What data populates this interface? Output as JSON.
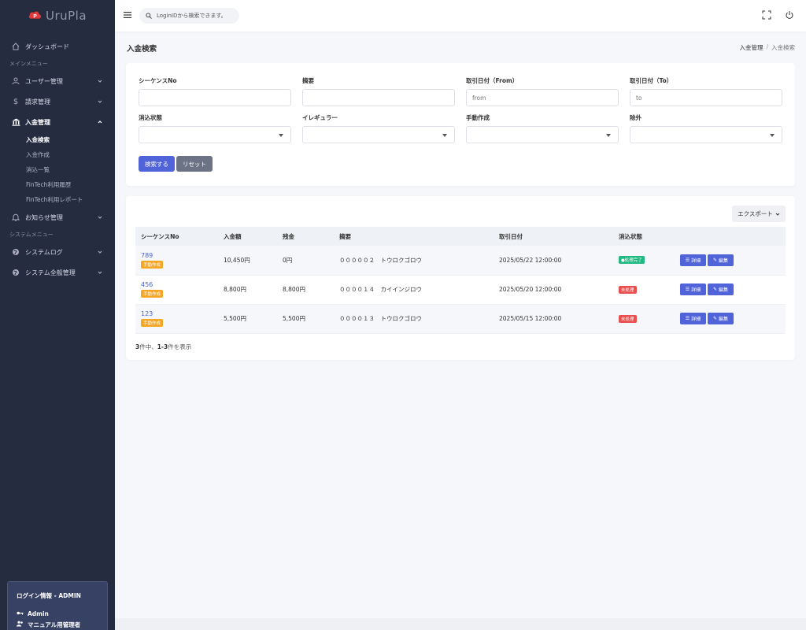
{
  "brand": {
    "name": "UruPla",
    "accent": "#e03a3a"
  },
  "sidebar": {
    "dashboard": "ダッシュボード",
    "section_main": "メインメニュー",
    "items": [
      {
        "label": "ユーザー管理",
        "icon": "user-icon"
      },
      {
        "label": "請求管理",
        "icon": "dollar-icon"
      },
      {
        "label": "入金管理",
        "icon": "bank-icon",
        "expanded": true
      }
    ],
    "sub_items": [
      "入金検索",
      "入金作成",
      "消込一覧",
      "FinTech利用履歴",
      "FinTech利用レポート"
    ],
    "notice": "お知らせ管理",
    "section_system": "システムメニュー",
    "system_items": [
      {
        "label": "システムログ",
        "icon": "globe-icon"
      },
      {
        "label": "システム全般管理",
        "icon": "globe-icon"
      }
    ],
    "login": {
      "title": "ログイン情報 - ADMIN",
      "user": "Admin",
      "role": "マニュアル用管理者"
    }
  },
  "topbar": {
    "search_placeholder": "LoginIDから検索できます。"
  },
  "page": {
    "title": "入金検索",
    "breadcrumb": {
      "parent": "入金管理",
      "sep": "/",
      "current": "入金検索"
    }
  },
  "filters": {
    "seq_label": "シーケンスNo",
    "summary_label": "摘要",
    "date_from_label": "取引日付（From）",
    "date_from_placeholder": "from",
    "date_to_label": "取引日付（To）",
    "date_to_placeholder": "to",
    "reconcile_label": "消込状態",
    "irregular_label": "イレギュラー",
    "manual_label": "手動作成",
    "exclude_label": "除外",
    "search_button": "検索する",
    "reset_button": "リセット"
  },
  "table": {
    "export_button": "エクスポート",
    "columns": [
      "シーケンスNo",
      "入金額",
      "残金",
      "摘要",
      "取引日付",
      "消込状態",
      ""
    ],
    "rows": [
      {
        "seq": "789",
        "tag": "手動作成",
        "amount": "10,450円",
        "balance": "0円",
        "summary": "０００００２　トウロクゴロウ",
        "date": "2025/05/22 12:00:00",
        "status": "●処理完了",
        "status_type": "done"
      },
      {
        "seq": "456",
        "tag": "手動作成",
        "amount": "8,800円",
        "balance": "8,800円",
        "summary": "００００１４　カイインジロウ",
        "date": "2025/05/20 12:00:00",
        "status": "未処理",
        "status_type": "pending"
      },
      {
        "seq": "123",
        "tag": "手動作成",
        "amount": "5,500円",
        "balance": "5,500円",
        "summary": "００００１３　トウロクゴロウ",
        "date": "2025/05/15 12:00:00",
        "status": "未処理",
        "status_type": "pending"
      }
    ],
    "detail_label": "詳細",
    "edit_label": "編集",
    "count_total": "3",
    "count_mid": "件中、",
    "count_range": "1-3",
    "count_suffix": "件を表示"
  }
}
